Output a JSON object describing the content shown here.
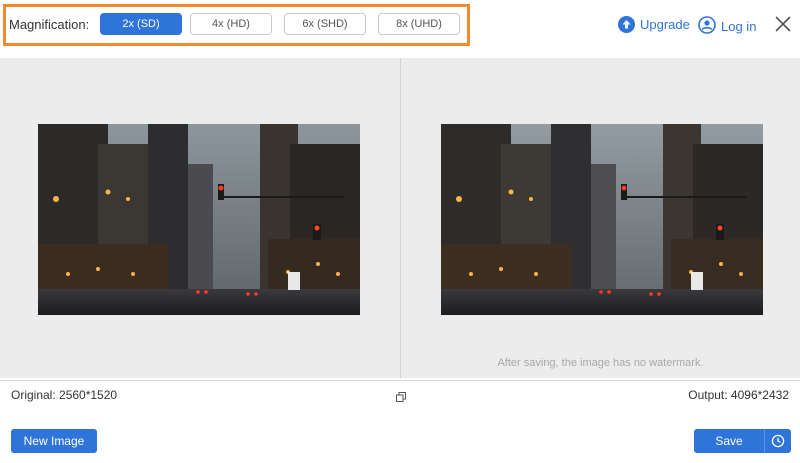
{
  "magnification": {
    "label": "Magnification:",
    "options": [
      "2x (SD)",
      "4x (HD)",
      "6x (SHD)",
      "8x (UHD)"
    ],
    "selected": "2x (SD)"
  },
  "header": {
    "upgrade_label": "Upgrade",
    "login_label": "Log in"
  },
  "preview": {
    "watermark_note": "After saving, the image has no watermark."
  },
  "info": {
    "original": "Original: 2560*1520",
    "output": "Output: 4096*2432"
  },
  "footer": {
    "new_image_label": "New Image",
    "save_label": "Save"
  },
  "colors": {
    "accent": "#2f74d8",
    "highlight_border": "#f28a2b"
  },
  "icons": [
    "upgrade-icon",
    "user-icon",
    "close-icon",
    "copy-icon",
    "history-icon"
  ]
}
